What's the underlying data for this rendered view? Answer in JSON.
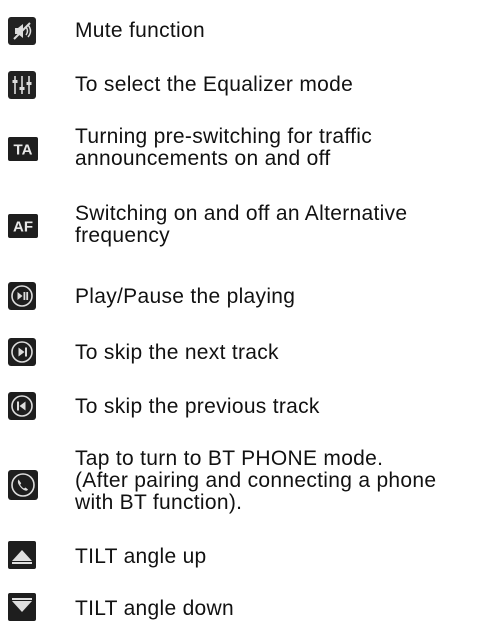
{
  "items": [
    {
      "icon": "mute-icon",
      "text": "Mute function"
    },
    {
      "icon": "equalizer-icon",
      "text": "To select the Equalizer mode"
    },
    {
      "icon": "ta-icon",
      "icon_text": "TA",
      "text": "Turning pre-switching for traffic\nannouncements on and off"
    },
    {
      "icon": "af-icon",
      "icon_text": "AF",
      "text": "Switching on and off an Alternative\nfrequency"
    },
    {
      "icon": "play-pause-icon",
      "text": "Play/Pause the playing"
    },
    {
      "icon": "next-track-icon",
      "text": "To skip the next track"
    },
    {
      "icon": "previous-track-icon",
      "text": "To skip the previous track"
    },
    {
      "icon": "phone-icon",
      "text": "Tap to turn to BT PHONE mode.\n(After pairing and connecting a phone\n with BT function)."
    },
    {
      "icon": "tilt-up-icon",
      "text": "TILT angle up"
    },
    {
      "icon": "tilt-down-icon",
      "text": "TILT angle down"
    }
  ]
}
